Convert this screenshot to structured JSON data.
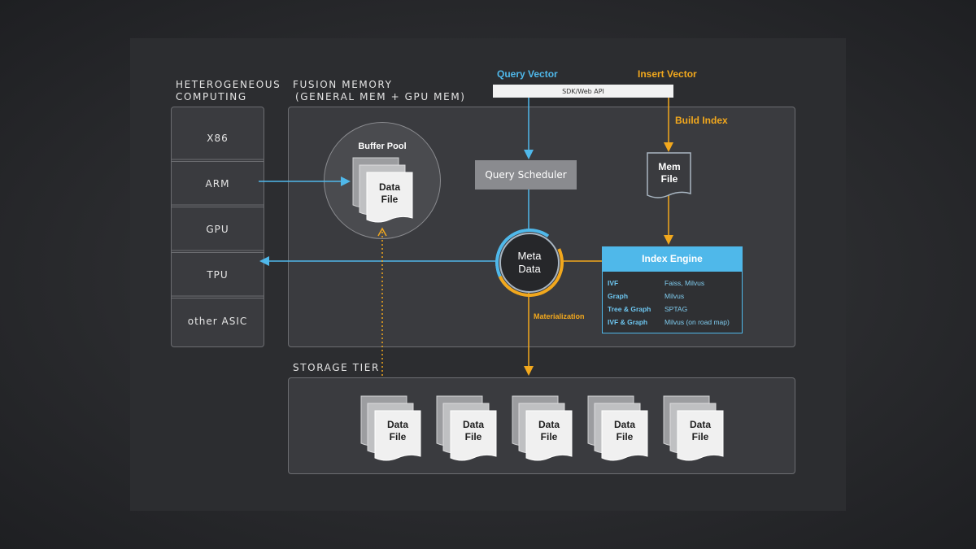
{
  "labels": {
    "heterogeneous_line1": "HETEROGENEOUS",
    "heterogeneous_line2": "COMPUTING",
    "fusion_line1": "FUSION MEMORY",
    "fusion_line2": "(GENERAL MEM + GPU MEM)",
    "storage_tier": "STORAGE TIER"
  },
  "computing": [
    "X86",
    "ARM",
    "GPU",
    "TPU",
    "other ASIC"
  ],
  "query_vector": "Query Vector",
  "insert_vector": "Insert Vector",
  "sdk_api": "SDK/Web API",
  "build_index": "Build Index",
  "buffer_pool": "Buffer Pool",
  "data_file": {
    "line1": "Data",
    "line2": "File"
  },
  "query_scheduler": "Query Scheduler",
  "mem_file": {
    "line1": "Mem",
    "line2": "File"
  },
  "meta_data": {
    "line1": "Meta",
    "line2": "Data"
  },
  "materialization": "Materialization",
  "index_engine": {
    "title": "Index Engine",
    "rows": [
      {
        "key": "IVF",
        "value": "Faiss, Milvus"
      },
      {
        "key": "Graph",
        "value": "Milvus"
      },
      {
        "key": "Tree & Graph",
        "value": "SPTAG"
      },
      {
        "key": "IVF & Graph",
        "value": "Milvus (on road map)"
      }
    ]
  },
  "colors": {
    "blue": "#4fb8ea",
    "orange": "#f2a81d",
    "panel": "#2c2d30"
  }
}
